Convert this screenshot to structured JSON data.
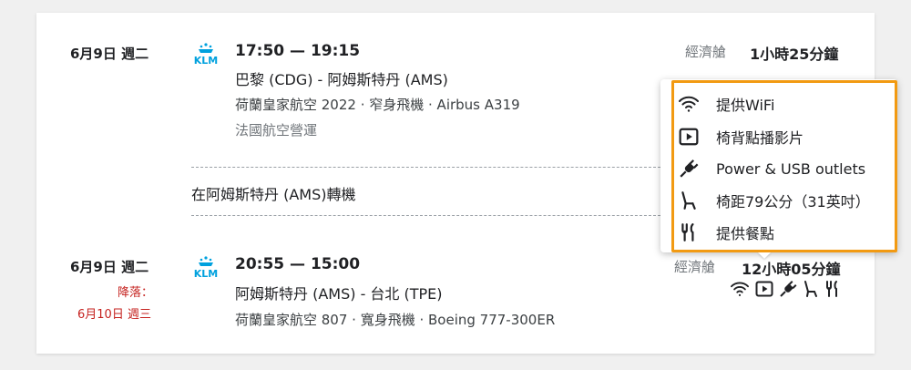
{
  "segment1": {
    "date": "6月9日 週二",
    "airline_logo": "KLM",
    "times": "17:50 — 19:15",
    "route": "巴黎 (CDG) - 阿姆斯特丹 (AMS)",
    "flight_info": "荷蘭皇家航空 2022 · 窄身飛機 · Airbus A319",
    "operator": "法國航空營運",
    "cabin": "經濟艙",
    "duration": "1小時25分鐘"
  },
  "transfer": {
    "text": "在阿姆斯特丹 (AMS)轉機"
  },
  "segment2": {
    "date": "6月9日 週二",
    "landing_label": "降落：",
    "landing_date": "6月10日 週三",
    "airline_logo": "KLM",
    "times": "20:55 — 15:00",
    "route": "阿姆斯特丹 (AMS) - 台北 (TPE)",
    "flight_info": "荷蘭皇家航空 807 · 寬身飛機 · Boeing 777-300ER",
    "cabin_partial": "經濟艙",
    "duration_partial": "12小時05分鐘",
    "amenity_icons": [
      "wifi-icon",
      "video-icon",
      "plug-icon",
      "seat-icon",
      "meal-icon"
    ]
  },
  "amenities_popup": {
    "items": [
      {
        "icon": "wifi-icon",
        "label": "提供WiFi"
      },
      {
        "icon": "video-icon",
        "label": "椅背點播影片"
      },
      {
        "icon": "plug-icon",
        "label": "Power & USB outlets"
      },
      {
        "icon": "seat-icon",
        "label": "椅距79公分（31英吋）"
      },
      {
        "icon": "meal-icon",
        "label": "提供餐點"
      }
    ],
    "highlight_color": "#f29a12"
  },
  "colors": {
    "klm_blue": "#00a1de",
    "landing_red": "#c5221f",
    "muted": "#70757a"
  }
}
